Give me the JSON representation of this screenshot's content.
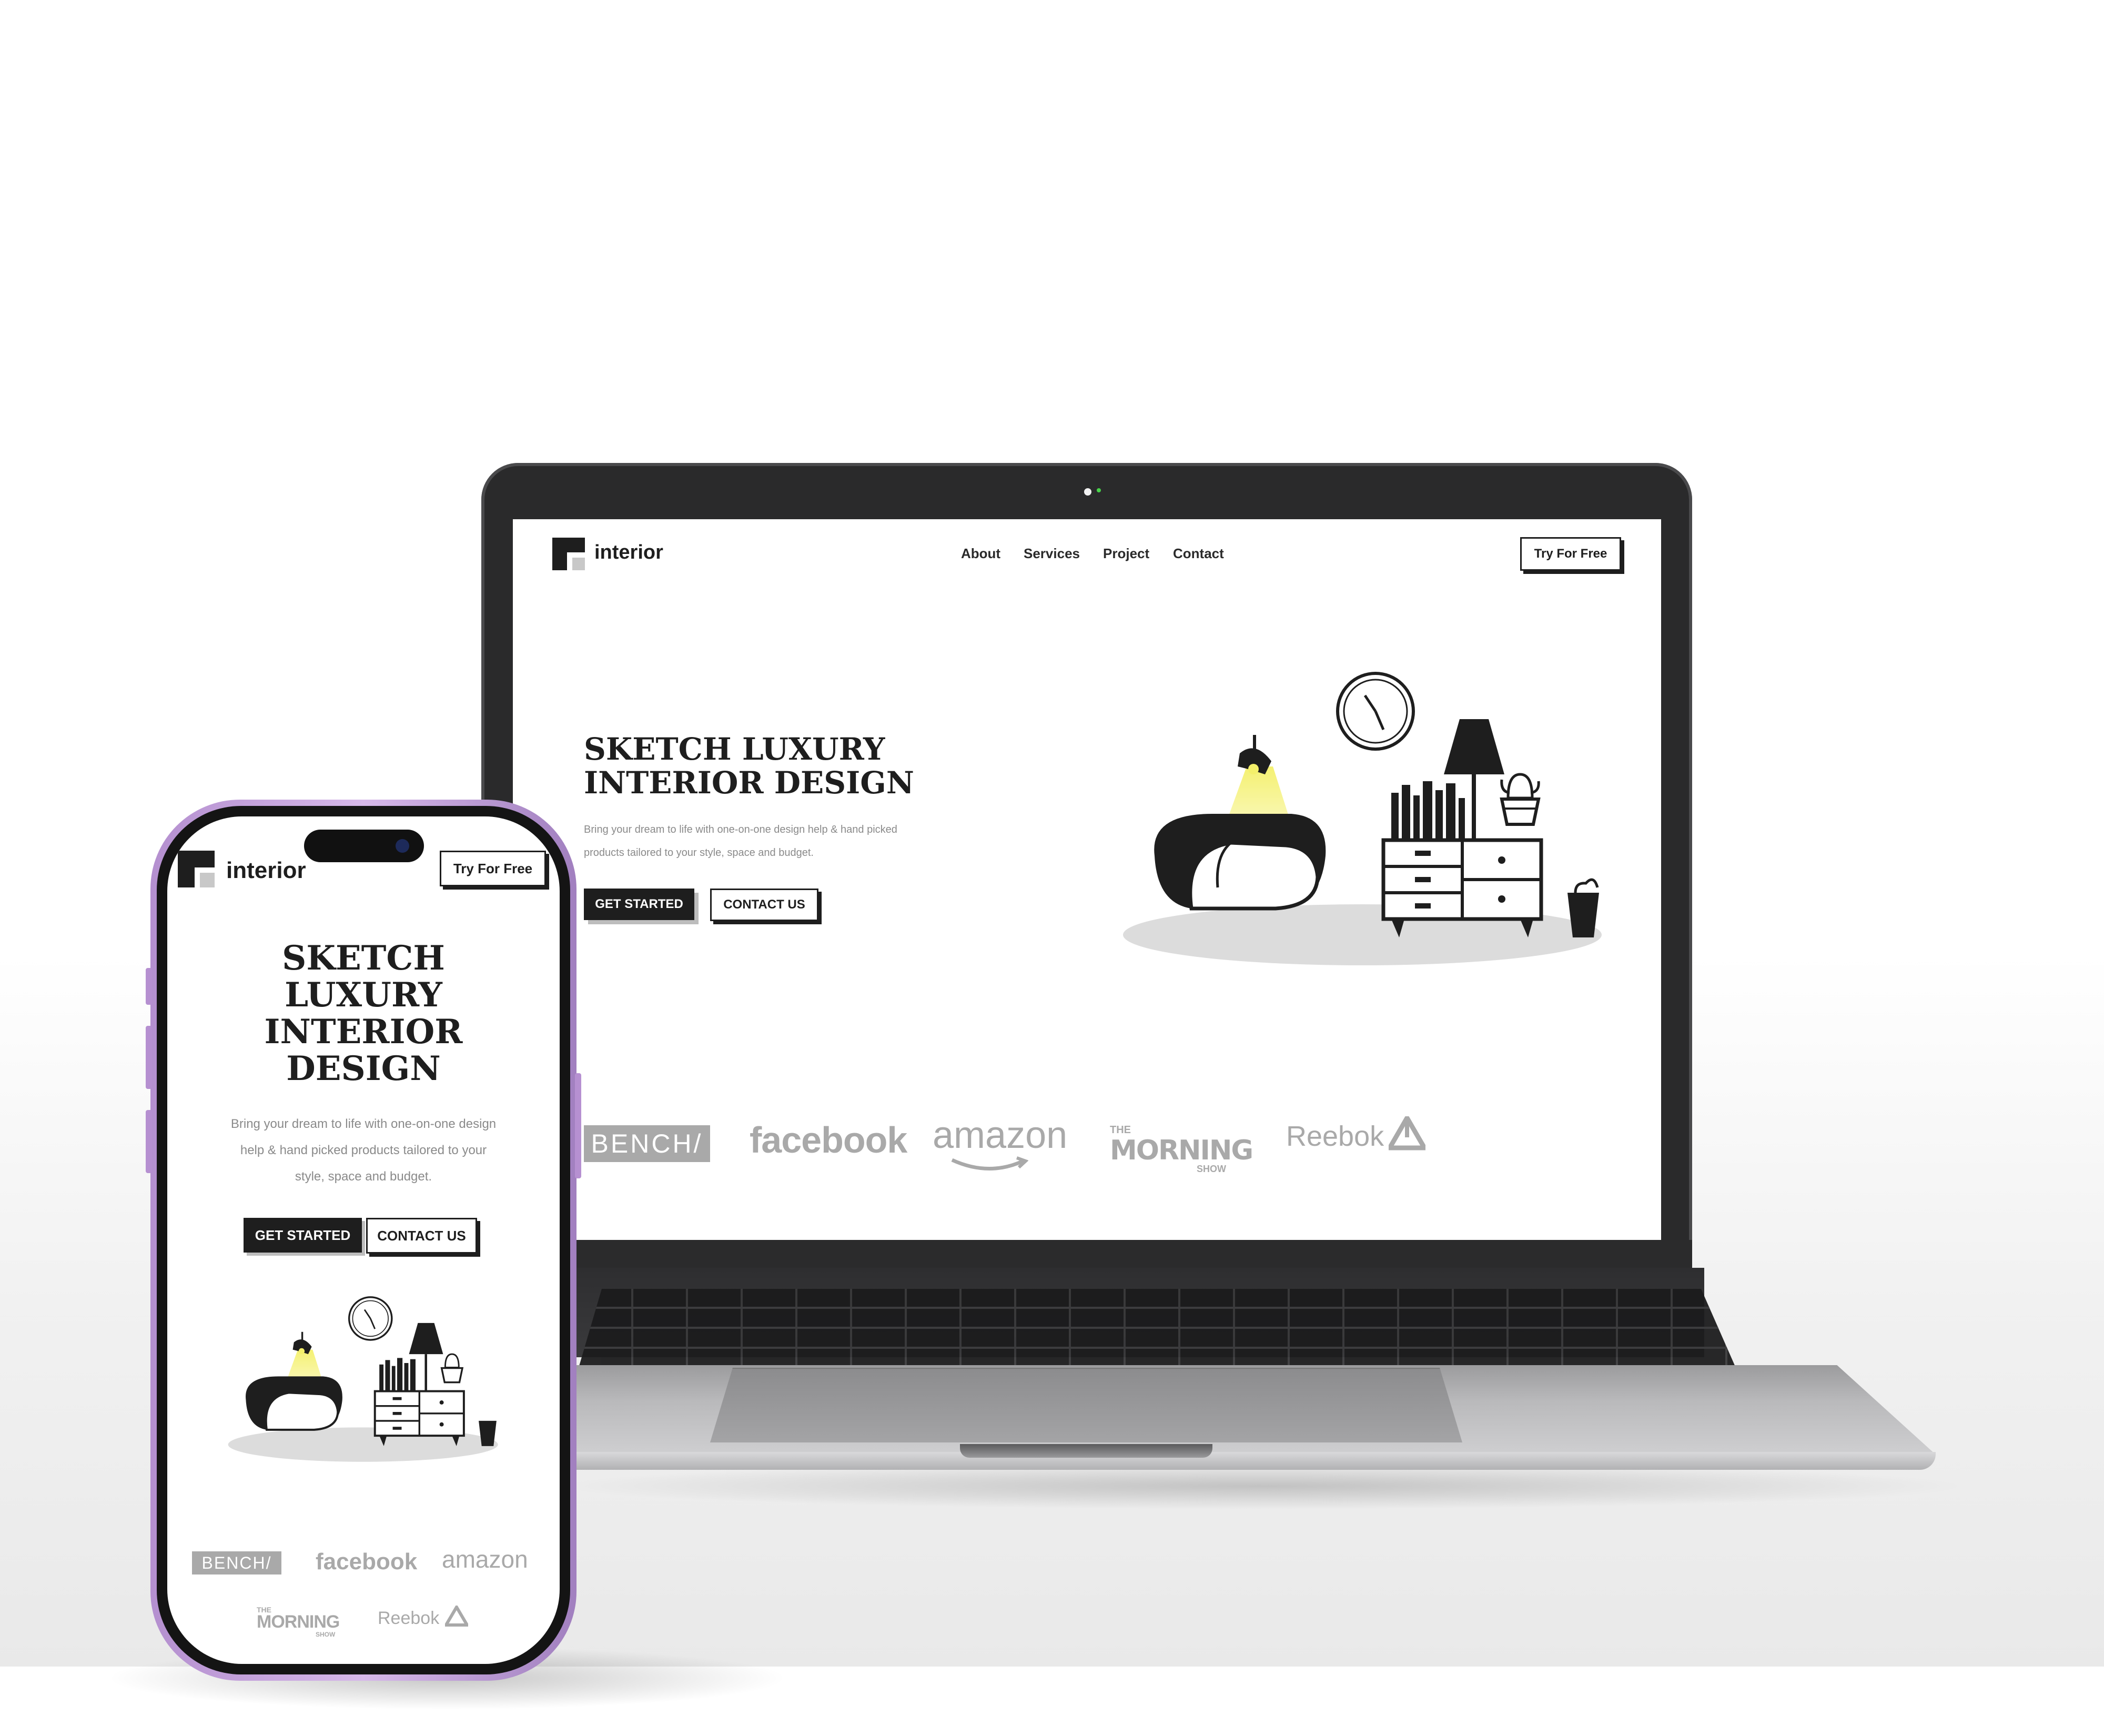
{
  "colors": {
    "ink": "#1e1e1e",
    "muted_text": "#8a8a8a",
    "brand_logos": "#a9a9a9",
    "lamp_glow": "#f4f06a",
    "phone_frame": "#c9a6e0",
    "laptop_lid": "#2a2a2b"
  },
  "laptop_site": {
    "logo_text": "interior",
    "nav": [
      "About",
      "Services",
      "Project",
      "Contact"
    ],
    "cta_label": "Try For Free",
    "hero_title_line1": "SKETCH LUXURY",
    "hero_title_line2": "INTERIOR DESIGN",
    "hero_sub_line1": "Bring your dream to life with one-on-one design help & hand picked",
    "hero_sub_line2": "products tailored to your style, space and budget.",
    "get_started_label": "GET STARTED",
    "contact_label": "CONTACT US",
    "brands": {
      "bench": "BENCH/",
      "facebook": "facebook",
      "amazon": "amazon",
      "morning_the": "THE",
      "morning_main": "MORNING",
      "morning_show": "SHOW",
      "reebok": "Reebok"
    }
  },
  "phone_site": {
    "logo_text": "interior",
    "cta_label": "Try For Free",
    "hero_title_lines": [
      "SKETCH",
      "LUXURY",
      "INTERIOR",
      "DESIGN"
    ],
    "hero_sub_lines": [
      "Bring your dream to life with one-on-one design",
      "help & hand picked products tailored to your",
      "style, space and budget."
    ],
    "get_started_label": "GET STARTED",
    "contact_label": "CONTACT US",
    "brands": {
      "bench": "BENCH/",
      "facebook": "facebook",
      "amazon": "amazon",
      "morning_the": "THE",
      "morning_main": "MORNING",
      "morning_show": "SHOW",
      "reebok": "Reebok"
    }
  },
  "icons": [
    "logo-mark-icon",
    "ceiling-lamp-icon",
    "wall-clock-icon",
    "floor-lamp-icon",
    "armchair-icon",
    "dresser-icon",
    "books-icon",
    "cactus-plant-icon",
    "waste-bin-icon",
    "reebok-delta-icon",
    "amazon-smile-icon",
    "camera-icon"
  ]
}
